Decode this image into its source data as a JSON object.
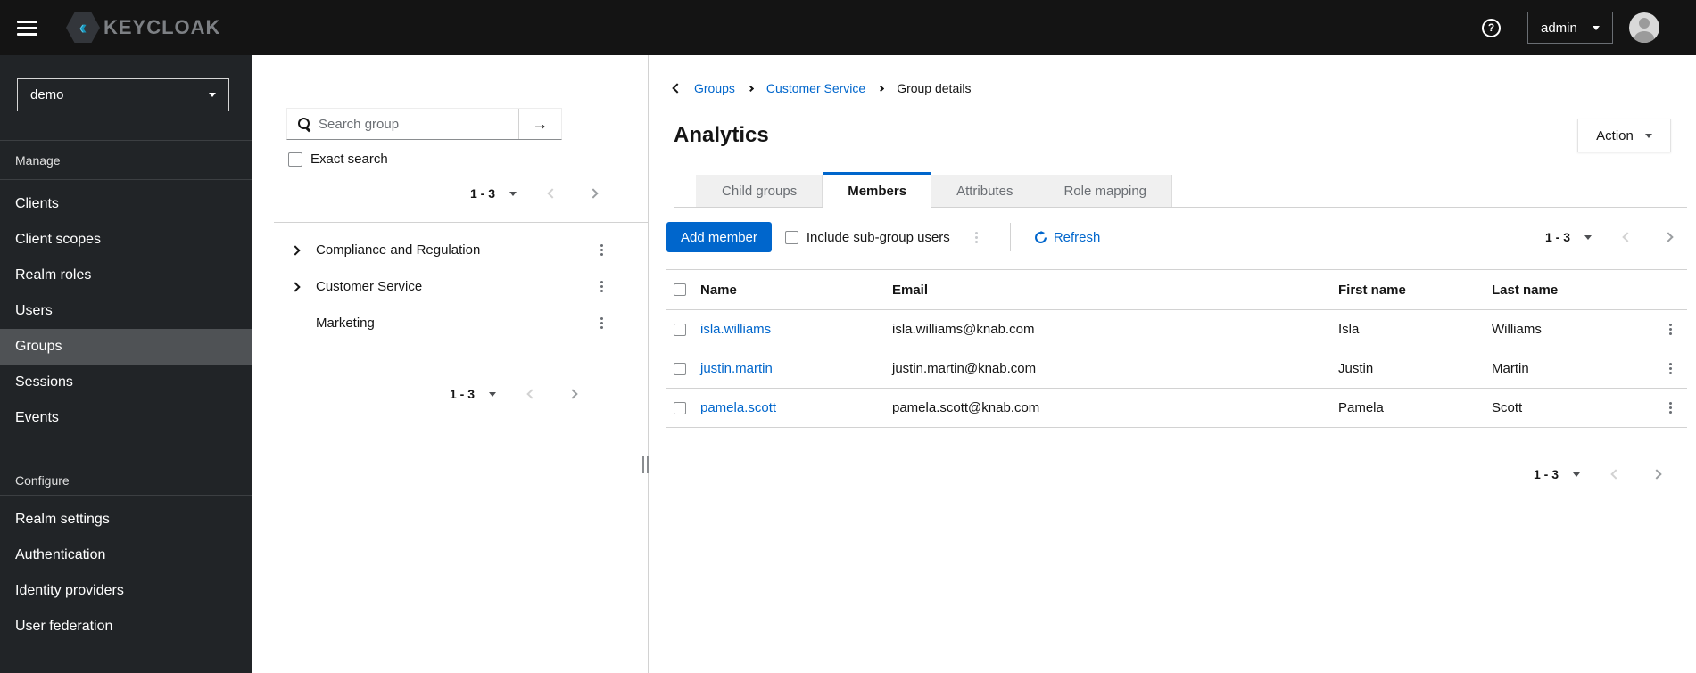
{
  "topbar": {
    "brand": "KEYCLOAK",
    "help_glyph": "?",
    "user": "admin"
  },
  "sidebar": {
    "realm": "demo",
    "manage": {
      "label": "Manage",
      "items": [
        "Clients",
        "Client scopes",
        "Realm roles",
        "Users",
        "Groups",
        "Sessions",
        "Events"
      ],
      "active_item": "Groups"
    },
    "configure": {
      "label": "Configure",
      "items": [
        "Realm settings",
        "Authentication",
        "Identity providers",
        "User federation"
      ]
    }
  },
  "groups_panel": {
    "search_placeholder": "Search group",
    "search_button_glyph": "→",
    "exact_search_label": "Exact search",
    "top_pagination": "1 - 3",
    "bottom_pagination": "1 - 3",
    "tree": [
      {
        "label": "Compliance and Regulation",
        "expandable": true
      },
      {
        "label": "Customer Service",
        "expandable": true
      },
      {
        "label": "Marketing",
        "expandable": false
      }
    ]
  },
  "main": {
    "breadcrumb": {
      "items": [
        "Groups",
        "Customer Service"
      ],
      "current": "Group details"
    },
    "title": "Analytics",
    "action_button": "Action",
    "tabs": [
      {
        "label": "Child groups",
        "active": false
      },
      {
        "label": "Members",
        "active": true
      },
      {
        "label": "Attributes",
        "active": false
      },
      {
        "label": "Role mapping",
        "active": false
      }
    ],
    "toolbar": {
      "add_member": "Add member",
      "include_subgroups": "Include sub-group users",
      "refresh": "Refresh",
      "pagination": "1 - 3"
    },
    "table": {
      "headers": [
        "Name",
        "Email",
        "First name",
        "Last name"
      ],
      "rows": [
        {
          "name": "isla.williams",
          "email": "isla.williams@knab.com",
          "first": "Isla",
          "last": "Williams"
        },
        {
          "name": "justin.martin",
          "email": "justin.martin@knab.com",
          "first": "Justin",
          "last": "Martin"
        },
        {
          "name": "pamela.scott",
          "email": "pamela.scott@knab.com",
          "first": "Pamela",
          "last": "Scott"
        }
      ]
    },
    "bottom_pagination": "1 - 3"
  },
  "colors": {
    "primary": "#0066cc",
    "link": "#0066cc",
    "topbar_bg": "#141414",
    "sidebar_bg": "#212427",
    "sidebar_active_bg": "#4f5255",
    "tab_inactive_bg": "#f0f0f0",
    "border": "#d2d2d2",
    "muted_text": "#6a6e73",
    "logo_cyan": "#54c6e8"
  }
}
